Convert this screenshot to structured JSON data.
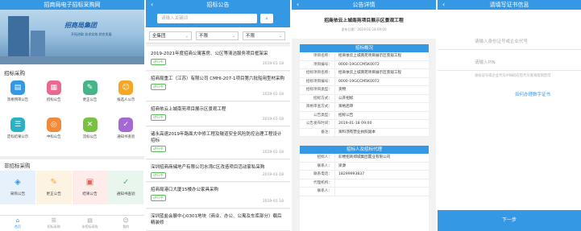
{
  "home": {
    "title": "招商局电子招标采购网",
    "brand": "招商局集团",
    "slogan": "开拓进取  务求实效  综合发展",
    "section1": "招标采购",
    "section2": "非招标采购",
    "tiles": [
      {
        "label": "资格预审公告",
        "color": "#3598e4",
        "icon": "document-icon"
      },
      {
        "label": "招标公告",
        "color": "#e86a8f",
        "icon": "notice-icon"
      },
      {
        "label": "更正公告",
        "color": "#46b489",
        "icon": "edit-icon"
      },
      {
        "label": "候选人公示",
        "color": "#f5a623",
        "icon": "person-icon"
      },
      {
        "label": "定标结果公示",
        "color": "#2cb1c4",
        "icon": "list-icon"
      },
      {
        "label": "中标公告",
        "color": "#f28a3c",
        "icon": "target-icon"
      },
      {
        "label": "流标公告",
        "color": "#7ac143",
        "icon": "cancel-icon"
      },
      {
        "label": "通知书查验",
        "color": "#a36ad1",
        "icon": "check-icon"
      }
    ],
    "nontender": [
      {
        "label": "采购公告",
        "bg": "#e6f1fb",
        "color": "#3598e4",
        "icon": "megaphone-icon"
      },
      {
        "label": "更正公告",
        "bg": "#fdf3e2",
        "color": "#f5a623",
        "icon": "edit-icon"
      },
      {
        "label": "结果公告",
        "bg": "#fdecea",
        "color": "#e8625a",
        "icon": "result-icon"
      },
      {
        "label": "通知书查验",
        "bg": "#e9f6ee",
        "color": "#46b489",
        "icon": "check-icon"
      }
    ],
    "tabs": [
      {
        "label": "首页",
        "icon": "⌂"
      },
      {
        "label": "招标采购",
        "icon": "☰"
      },
      {
        "label": "非招标采购",
        "icon": "▤"
      },
      {
        "label": "我的",
        "icon": "☺"
      }
    ]
  },
  "list": {
    "title": "招标公告",
    "search_placeholder": "请输入关键词",
    "filters": [
      "全集团",
      "不限",
      "不限"
    ],
    "items": [
      {
        "title": "2019-2021年度招商公寓客房、公区等清洁服务项目框架采",
        "status": "进行中",
        "date": "2019-01-18"
      },
      {
        "title": "招商局重工（江苏）有限公司 CMHI-207-1项目第六批船用型材采购",
        "status": "进行中",
        "date": "2019-01-18"
      },
      {
        "title": "招商依云上城南苑项目展示区景观工程",
        "status": "进行中",
        "date": "2019-01-18"
      },
      {
        "title": "诸永高速2019年路面大中修工程及隧道安全风险防控治理工程设计招标",
        "status": "进行中",
        "date": "2019-01-18"
      },
      {
        "title": "深圳招商商储地产有限公司水湾C区改造项目活动家私采购",
        "status": "进行中",
        "date": "2019-01-18"
      },
      {
        "title": "招商局港口大厦15楼办公家具采购",
        "status": "进行中",
        "date": "2019-01-18"
      },
      {
        "title": "深圳蓝盐会展中心0301地块（商业、办公、公寓及车库部分）载后精装修"
      }
    ]
  },
  "detail": {
    "title": "公告详情",
    "doc_title": "招商依云上城南苑项目展示区景观工程",
    "publish_label": "发布日期：",
    "publish_date": "2019-01-18 09:00",
    "section_overview": "招标概况",
    "section_agent": "招标人及招标代理",
    "rows": [
      {
        "k": "项目名称：",
        "v": "招商依云上城南苑项目展示区景观工程"
      },
      {
        "k": "项目编号：",
        "v": "0000-19GCCM5K0072"
      },
      {
        "k": "招标项目名称：",
        "v": "招商依云上城南苑项目展示区景观工程"
      },
      {
        "k": "招标项目编号：",
        "v": "0000-19GCCM5K0072"
      },
      {
        "k": "招标项目类型：",
        "v": "货物"
      },
      {
        "k": "招标方式：",
        "v": "公开招标"
      },
      {
        "k": "资格审查方式：",
        "v": "资格后审"
      },
      {
        "k": "公告类型：",
        "v": "招标公告"
      },
      {
        "k": "公告发布时间：",
        "v": "2019-01-18 09:00"
      },
      {
        "k": "备注：",
        "v": "资料须有营业执照副本"
      }
    ],
    "agent_rows": [
      {
        "k": "招标人：",
        "v": "彩楼招商郑城集团置业有限公司"
      },
      {
        "k": "联系人：",
        "v": "梁源"
      },
      {
        "k": "联系电话：",
        "v": "18299993837"
      },
      {
        "k": "代理机构：",
        "v": ""
      },
      {
        "k": "联系人：",
        "v": ""
      }
    ]
  },
  "verify": {
    "title": "请填写证书信息",
    "field1_placeholder": "请输入身份证号或企业代号",
    "field2_placeholder": "请输入PIN",
    "tip": "身份证号或企业代号/PIN码在您代号查询等到后可",
    "link": "如何办理数字证书",
    "next": "下一步"
  }
}
